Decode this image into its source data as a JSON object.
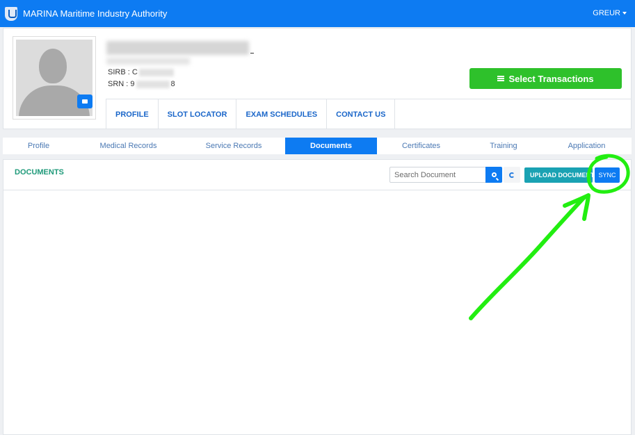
{
  "navbar": {
    "title": "MARINA Maritime Industry Authority",
    "user": "GREUR",
    "logo_icon": "marina-shield-logo"
  },
  "profile": {
    "sirb_label": "SIRB : C",
    "srn_label": "SRN : 9",
    "srn_suffix": "8",
    "select_transactions": "Select Transactions",
    "nav": [
      "PROFILE",
      "SLOT LOCATOR",
      "EXAM SCHEDULES",
      "CONTACT US"
    ]
  },
  "tabs": [
    "Profile",
    "Medical Records",
    "Service Records",
    "Documents",
    "Certificates",
    "Training",
    "Application"
  ],
  "active_tab": "Documents",
  "documents": {
    "title": "DOCUMENTS",
    "search_placeholder": "Search Document",
    "upload_label": "UPLOAD DOCUMENT",
    "sync_label": "SYNC"
  },
  "colors": {
    "primary": "#0d7bf2",
    "success": "#2ec12b",
    "teal": "#1aa2b3",
    "annotation": "#22ee11"
  }
}
